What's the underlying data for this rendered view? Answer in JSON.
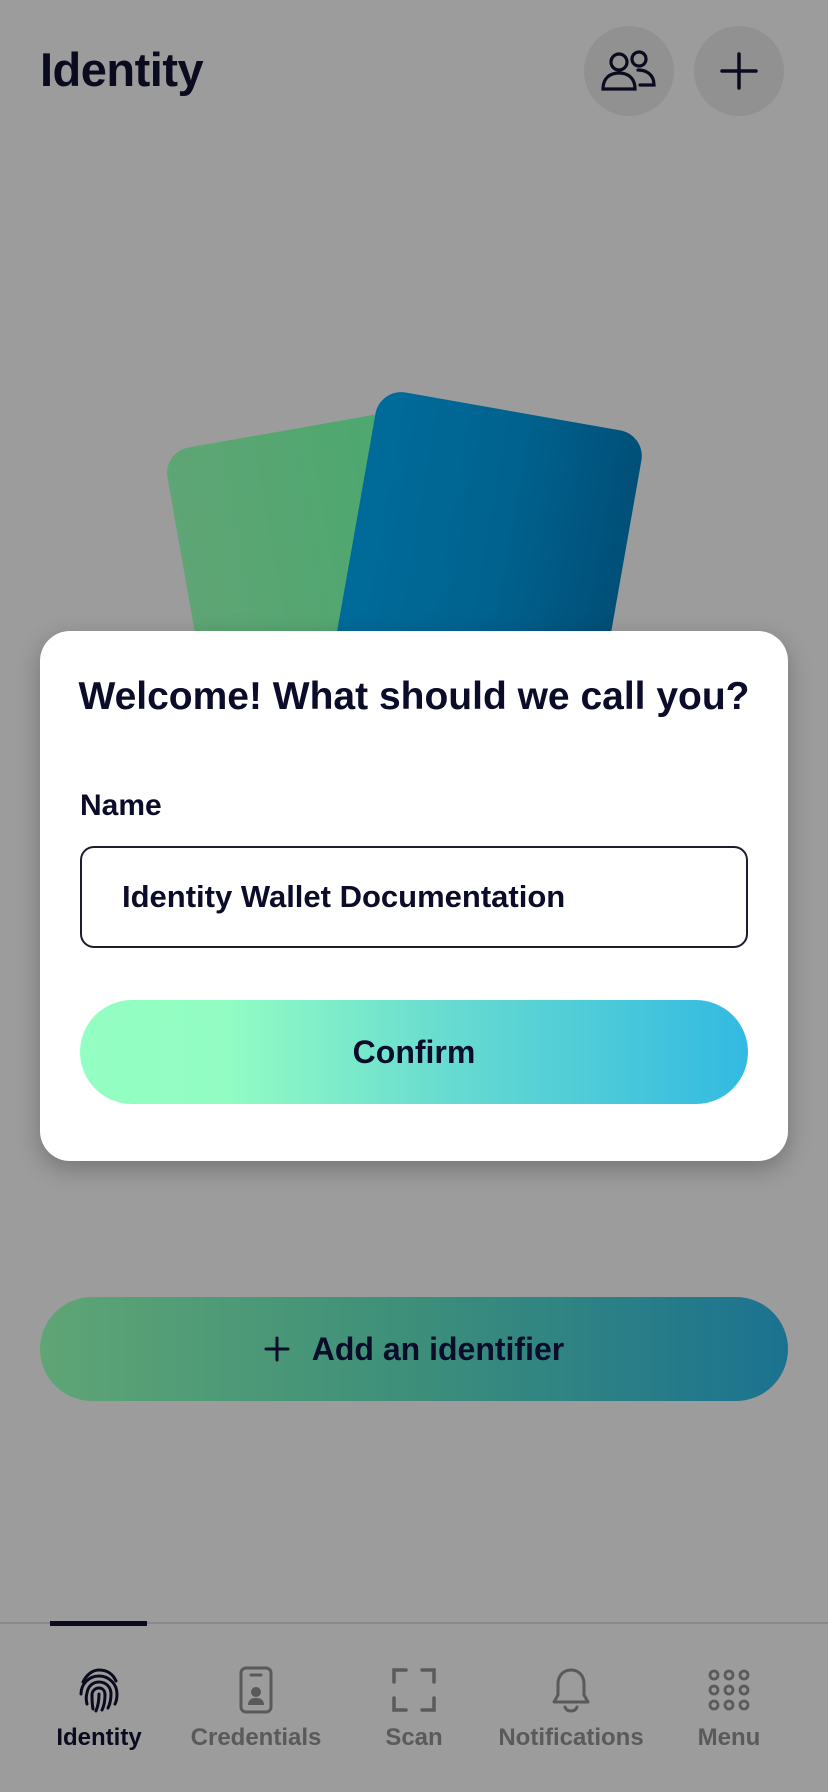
{
  "header": {
    "title": "Identity",
    "buttons": [
      {
        "icon": "people-icon",
        "label": "Connections"
      },
      {
        "icon": "plus-icon",
        "label": "Add"
      }
    ]
  },
  "dialog": {
    "title": "Welcome! What should we call you?",
    "field_label": "Name",
    "name_value": "Identity Wallet Documentation",
    "confirm_label": "Confirm"
  },
  "add_identifier": {
    "label": "Add an identifier",
    "icon": "plus-icon"
  },
  "bottom_nav": {
    "active": "Identity",
    "items": [
      {
        "label": "Identity",
        "icon": "fingerprint-icon"
      },
      {
        "label": "Credentials",
        "icon": "id-card-icon"
      },
      {
        "label": "Scan",
        "icon": "scan-icon"
      },
      {
        "label": "Notifications",
        "icon": "bell-icon"
      },
      {
        "label": "Menu",
        "icon": "grid-icon"
      }
    ]
  },
  "colors": {
    "overlay_bg": "#9c9c9c",
    "dialog_bg": "#ffffff",
    "text_dark": "#0b0b2a",
    "confirm_gradient_start": "#94ffc2",
    "confirm_gradient_end": "#33bae2",
    "card_green": "#4aa86e",
    "card_blue": "#006b9a"
  }
}
